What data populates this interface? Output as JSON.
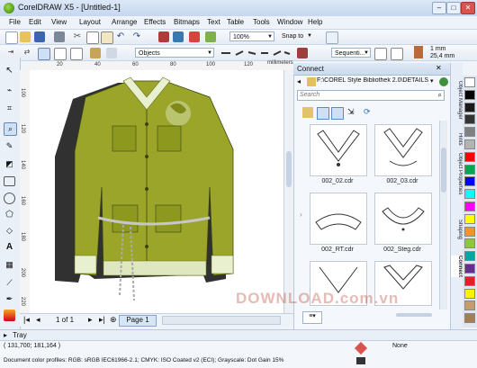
{
  "window": {
    "title": "CorelDRAW X5 - [Untitled-1]"
  },
  "menu": [
    "File",
    "Edit",
    "View",
    "Layout",
    "Arrange",
    "Effects",
    "Bitmaps",
    "Text",
    "Table",
    "Tools",
    "Window",
    "Help"
  ],
  "standard_toolbar": {
    "zoom": "100%",
    "snap_to": "Snap to"
  },
  "property_bar": {
    "objects_combo": "Objects",
    "sequence_combo": "Sequenti...",
    "size_1": "1 mm",
    "size_2": "25,4 mm"
  },
  "ruler": {
    "unit": "millimeters",
    "h_ticks": [
      "20",
      "40",
      "60",
      "80",
      "100",
      "120"
    ],
    "v_ticks": [
      "100",
      "120",
      "140",
      "160",
      "180",
      "200",
      "220"
    ]
  },
  "page_nav": {
    "count": "1 of 1",
    "page_tab": "Page 1"
  },
  "docker": {
    "title": "Connect",
    "path": "F:\\COREL Style Bibliothek 2.0\\DETAILS\\Hal",
    "search_placeholder": "Search",
    "items": [
      {
        "file": "002_02.cdr"
      },
      {
        "file": "002_03.cdr"
      },
      {
        "file": "002_RT.cdr"
      },
      {
        "file": "002_Steg.cdr"
      }
    ],
    "side_tabs": [
      "Object Manager",
      "Hints",
      "Object Properties",
      "Shaping",
      "Connect"
    ]
  },
  "tray": {
    "label": "Tray"
  },
  "status": {
    "coords": "( 131,700; 181,164 )",
    "color_profiles": "Document color profiles: RGB: sRGB IEC61966-2.1; CMYK: ISO Coated v2 (ECI); Grayscale: Dot Gain 15%",
    "fill_label": "None"
  },
  "watermark": "DOWNLOAD.com.vn",
  "palette_colors": [
    "#ffffff",
    "#000000",
    "#1a1a1a",
    "#333333",
    "#808080",
    "#b3b3b3",
    "#ff0000",
    "#00a651",
    "#0000ff",
    "#00ffff",
    "#ff00ff",
    "#ffff00",
    "#f7941d",
    "#8dc63f",
    "#00a99d",
    "#662d91",
    "#ed1c24",
    "#fff200",
    "#c69c6d",
    "#a67c52"
  ],
  "accent": {
    "jacket": "#9aa52a",
    "jacket_dark": "#707a18",
    "ui_blue": "#2b6cc4"
  }
}
